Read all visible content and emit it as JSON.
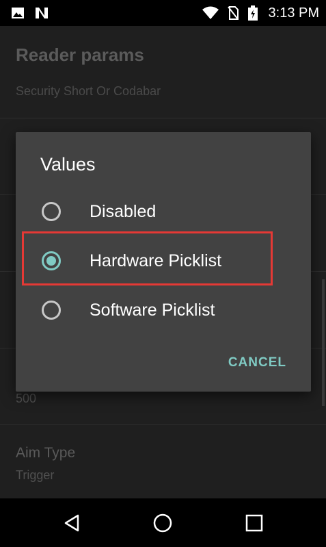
{
  "status_bar": {
    "time": "3:13 PM",
    "icons": [
      "image-icon",
      "n-notification-icon",
      "wifi-icon",
      "no-sim-icon",
      "battery-charging-icon"
    ]
  },
  "background": {
    "title": "Reader params",
    "subtitle": "Security Short Or Codabar",
    "partial_value": "500",
    "item_aim_type": {
      "title": "Aim Type",
      "value": "Trigger"
    }
  },
  "dialog": {
    "title": "Values",
    "options": [
      {
        "label": "Disabled",
        "selected": false
      },
      {
        "label": "Hardware Picklist",
        "selected": true
      },
      {
        "label": "Software Picklist",
        "selected": false
      }
    ],
    "cancel_label": "CANCEL",
    "accent_color": "#80cbc4",
    "highlight_color": "#e53935"
  },
  "nav_bar": {
    "buttons": [
      "back-icon",
      "home-icon",
      "recents-icon"
    ]
  }
}
